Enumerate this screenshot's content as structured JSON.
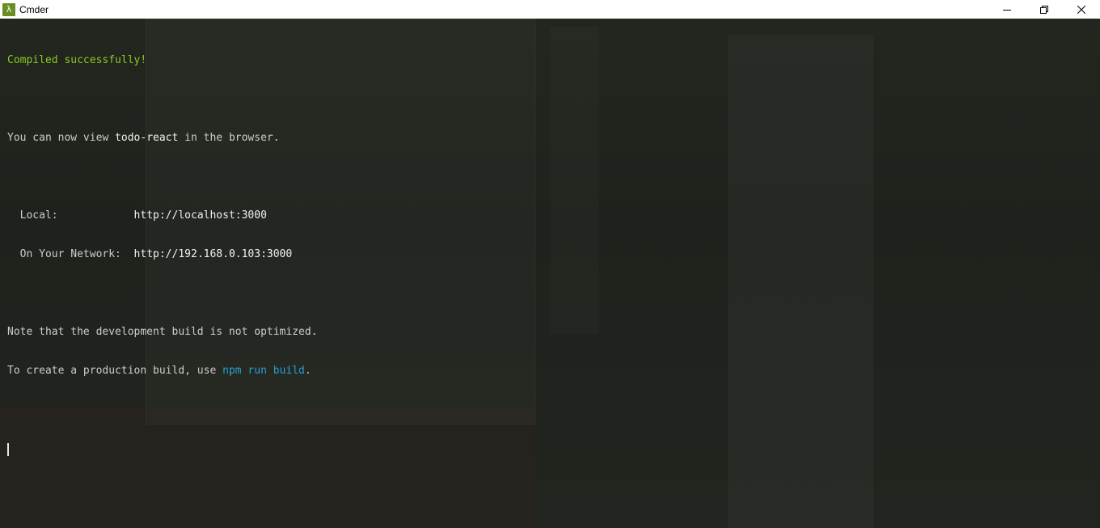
{
  "window": {
    "title": "Cmder",
    "icon": "lambda-icon",
    "controls": [
      "minimize-icon",
      "restore-icon",
      "close-icon"
    ]
  },
  "terminal": {
    "compiled": "Compiled successfully!",
    "view_prefix": "You can now view ",
    "app_name": "todo-react",
    "view_suffix": " in the browser.",
    "local_label": "  Local:            ",
    "local_url": "http://localhost:3000",
    "network_label": "  On Your Network:  ",
    "network_url": "http://192.168.0.103:3000",
    "note": "Note that the development build is not optimized.",
    "prod_prefix": "To create a production build, use ",
    "prod_cmd": "npm run build",
    "prod_suffix": "."
  },
  "colors": {
    "success": "#8ac926",
    "command": "#2aa1d3",
    "text": "#cccccc",
    "background": "#1e211b"
  }
}
